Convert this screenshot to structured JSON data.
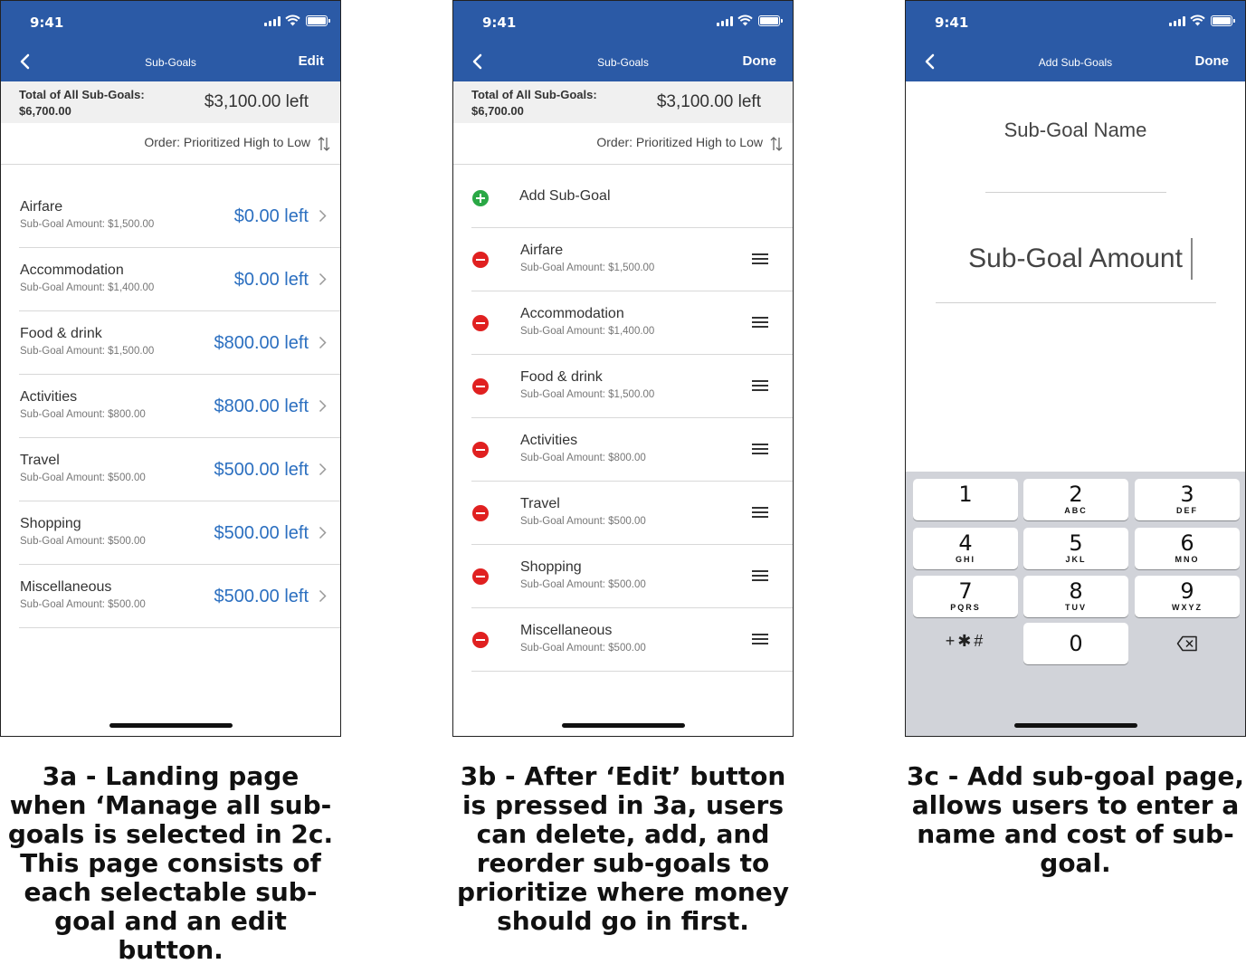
{
  "status": {
    "time": "9:41"
  },
  "screen_a": {
    "nav_title": "Sub-Goals",
    "nav_action": "Edit",
    "summary": {
      "label_line1": "Total of All Sub-Goals:",
      "label_line2": "$6,700.00",
      "left": "$3,100.00 left"
    },
    "order": "Order: Prioritized High to Low",
    "items": [
      {
        "name": "Airfare",
        "amount": "Sub-Goal Amount: $1,500.00",
        "left": "$0.00 left"
      },
      {
        "name": "Accommodation",
        "amount": "Sub-Goal Amount: $1,400.00",
        "left": "$0.00 left"
      },
      {
        "name": "Food & drink",
        "amount": "Sub-Goal Amount: $1,500.00",
        "left": "$800.00 left"
      },
      {
        "name": "Activities",
        "amount": "Sub-Goal Amount: $800.00",
        "left": "$800.00 left"
      },
      {
        "name": "Travel",
        "amount": "Sub-Goal Amount: $500.00",
        "left": "$500.00 left"
      },
      {
        "name": "Shopping",
        "amount": "Sub-Goal Amount: $500.00",
        "left": "$500.00 left"
      },
      {
        "name": "Miscellaneous",
        "amount": "Sub-Goal Amount: $500.00",
        "left": "$500.00 left"
      }
    ]
  },
  "screen_b": {
    "nav_title": "Sub-Goals",
    "nav_action": "Done",
    "summary": {
      "label_line1": "Total of All Sub-Goals:",
      "label_line2": "$6,700.00",
      "left": "$3,100.00 left"
    },
    "order": "Order: Prioritized High to Low",
    "add_label": "Add Sub-Goal",
    "items": [
      {
        "name": "Airfare",
        "amount": "Sub-Goal Amount: $1,500.00"
      },
      {
        "name": "Accommodation",
        "amount": "Sub-Goal Amount: $1,400.00"
      },
      {
        "name": "Food & drink",
        "amount": "Sub-Goal Amount: $1,500.00"
      },
      {
        "name": "Activities",
        "amount": "Sub-Goal Amount: $800.00"
      },
      {
        "name": "Travel",
        "amount": "Sub-Goal Amount: $500.00"
      },
      {
        "name": "Shopping",
        "amount": "Sub-Goal Amount: $500.00"
      },
      {
        "name": "Miscellaneous",
        "amount": "Sub-Goal Amount: $500.00"
      }
    ]
  },
  "screen_c": {
    "nav_title": "Add Sub-Goals",
    "nav_action": "Done",
    "name_placeholder": "Sub-Goal Name",
    "amount_placeholder": "Sub-Goal Amount",
    "keys": [
      {
        "num": "1",
        "letters": ""
      },
      {
        "num": "2",
        "letters": "ABC"
      },
      {
        "num": "3",
        "letters": "DEF"
      },
      {
        "num": "4",
        "letters": "GHI"
      },
      {
        "num": "5",
        "letters": "JKL"
      },
      {
        "num": "6",
        "letters": "MNO"
      },
      {
        "num": "7",
        "letters": "PQRS"
      },
      {
        "num": "8",
        "letters": "TUV"
      },
      {
        "num": "9",
        "letters": "WXYZ"
      },
      {
        "num": "0",
        "letters": ""
      }
    ],
    "symbols": "+✱#"
  },
  "captions": {
    "a": "3a - Landing page when ‘Manage all sub-goals is selected in 2c. This page consists of each selectable sub-goal and an edit button.",
    "b": "3b - After ‘Edit’ button is pressed in 3a, users can delete, add, and reorder sub-goals to prioritize where money should go in first.",
    "c": "3c - Add sub-goal page, allows users to enter a name and cost of sub-goal."
  },
  "colors": {
    "nav_blue": "#2b5aa6",
    "value_blue": "#2b6fc0",
    "add_green": "#2aa845",
    "delete_red": "#e02020"
  }
}
